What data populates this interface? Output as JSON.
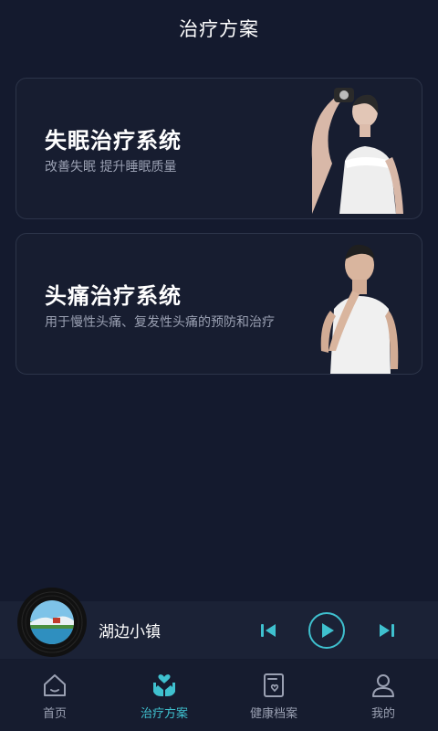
{
  "header": {
    "title": "治疗方案"
  },
  "cards": [
    {
      "title": "失眠治疗系统",
      "subtitle": "改善失眠 提升睡眠质量"
    },
    {
      "title": "头痛治疗系统",
      "subtitle": "用于慢性头痛、复发性头痛的预防和治疗"
    }
  ],
  "player": {
    "song_title": "湖边小镇"
  },
  "tabbar": {
    "items": [
      {
        "label": "首页",
        "icon": "home-icon"
      },
      {
        "label": "治疗方案",
        "icon": "care-hands-icon"
      },
      {
        "label": "健康档案",
        "icon": "health-record-icon"
      },
      {
        "label": "我的",
        "icon": "user-icon"
      }
    ],
    "active_index": 1
  },
  "colors": {
    "background": "#141a2e",
    "accent": "#3fc1cf",
    "muted_text": "#9aa0b2",
    "card_border": "#2c3449"
  }
}
